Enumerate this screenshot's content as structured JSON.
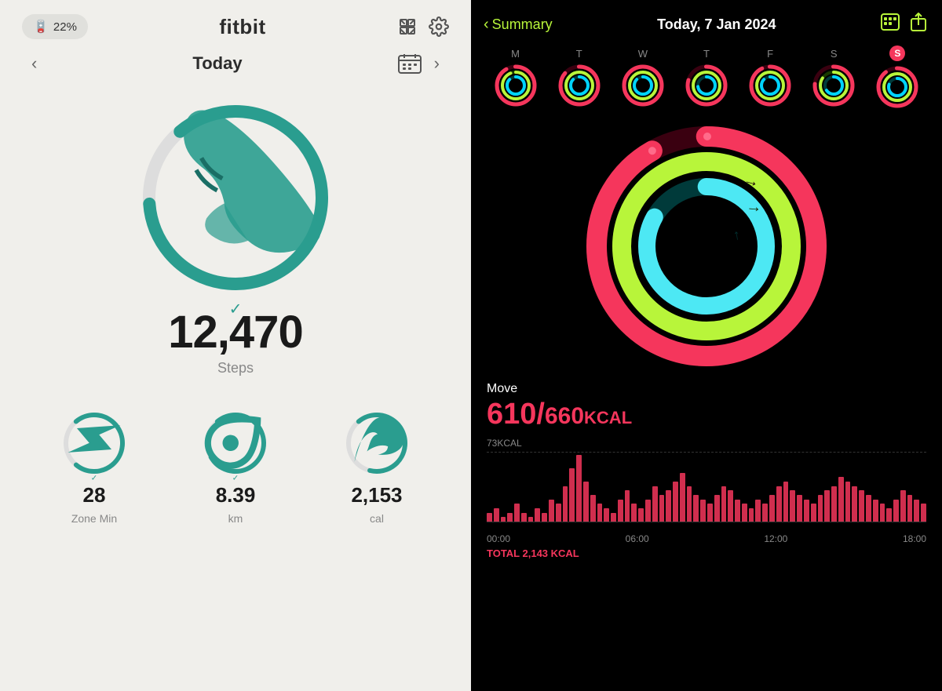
{
  "fitbit": {
    "battery": "22%",
    "logo": "fitbit",
    "nav": {
      "prev_label": "<",
      "title": "Today",
      "next_label": ">",
      "calendar_label": "📅"
    },
    "steps": {
      "value": "12,470",
      "label": "Steps",
      "ring_progress": 0.85
    },
    "stats": [
      {
        "id": "zone-min",
        "icon": "⚡",
        "value": "28",
        "unit": "Zone Min",
        "progress": 0.72
      },
      {
        "id": "km",
        "icon": "📍",
        "value": "8.39",
        "unit": "km",
        "progress": 0.78
      },
      {
        "id": "cal",
        "icon": "🔥",
        "value": "2,153",
        "unit": "cal",
        "progress": 0.65
      }
    ]
  },
  "activity": {
    "back_label": "Summary",
    "date": "Today, 7 Jan 2024",
    "week_days": [
      {
        "label": "M",
        "is_today": false
      },
      {
        "label": "T",
        "is_today": false
      },
      {
        "label": "W",
        "is_today": false
      },
      {
        "label": "T",
        "is_today": false
      },
      {
        "label": "F",
        "is_today": false
      },
      {
        "label": "S",
        "is_today": false
      },
      {
        "label": "S",
        "is_today": true
      }
    ],
    "rings": {
      "move": {
        "current": 610,
        "goal": 660,
        "unit": "KCAL",
        "color": "#f5365c"
      },
      "exercise": {
        "current": 45,
        "goal": 30,
        "color": "#b8f53a"
      },
      "stand": {
        "current": 10,
        "goal": 12,
        "color": "#00d4ff"
      }
    },
    "move_label": "Move",
    "move_display": "610/660KCAL",
    "chart": {
      "max_label": "73KCAL",
      "x_labels": [
        "00:00",
        "06:00",
        "12:00",
        "18:00"
      ],
      "total_label": "TOTAL 2,143 KCAL",
      "bars": [
        2,
        3,
        1,
        2,
        4,
        2,
        1,
        3,
        2,
        5,
        4,
        8,
        12,
        15,
        9,
        6,
        4,
        3,
        2,
        5,
        7,
        4,
        3,
        5,
        8,
        6,
        7,
        9,
        11,
        8,
        6,
        5,
        4,
        6,
        8,
        7,
        5,
        4,
        3,
        5,
        4,
        6,
        8,
        9,
        7,
        6,
        5,
        4,
        6,
        7,
        8,
        10,
        9,
        8,
        7,
        6,
        5,
        4,
        3,
        5,
        7,
        6,
        5,
        4
      ]
    }
  }
}
